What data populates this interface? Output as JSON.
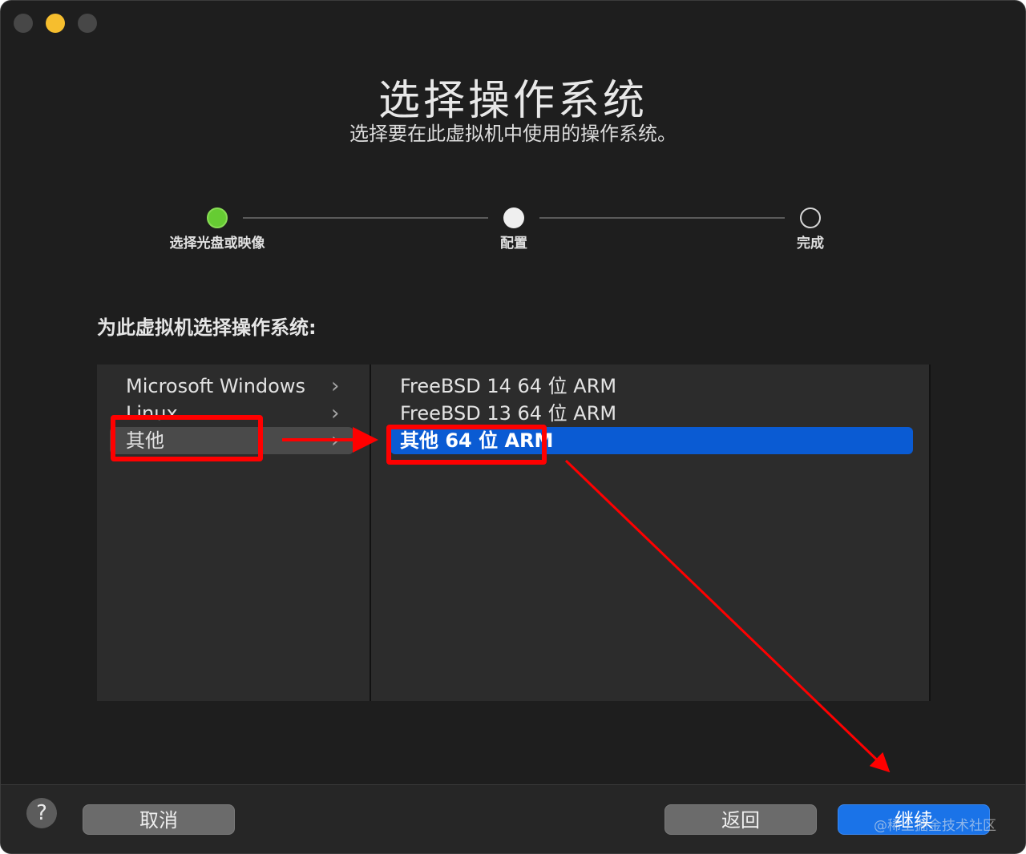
{
  "window": {
    "title": "选择操作系统",
    "subtitle": "选择要在此虚拟机中使用的操作系统。"
  },
  "steps": [
    {
      "label": "选择光盘或映像",
      "state": "done"
    },
    {
      "label": "配置",
      "state": "current"
    },
    {
      "label": "完成",
      "state": "todo"
    }
  ],
  "prompt": "为此虚拟机选择操作系统:",
  "categories": [
    {
      "label": "Microsoft Windows"
    },
    {
      "label": "Linux"
    },
    {
      "label": "其他",
      "selected": true
    }
  ],
  "versions": [
    {
      "label": "FreeBSD 14 64 位 ARM"
    },
    {
      "label": "FreeBSD 13 64 位 ARM"
    },
    {
      "label": "其他 64 位 ARM",
      "selected": true
    }
  ],
  "buttons": {
    "help": "?",
    "cancel": "取消",
    "back": "返回",
    "continue": "继续"
  },
  "watermark": "@稀土掘金技术社区",
  "colors": {
    "accent": "#0a5bd3",
    "step_done": "#66cc33",
    "annotation": "#ff0000",
    "traffic_minimize": "#f6be2e"
  }
}
